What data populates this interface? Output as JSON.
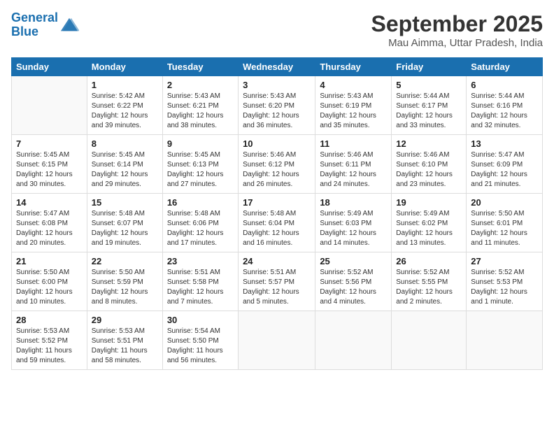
{
  "logo": {
    "line1": "General",
    "line2": "Blue"
  },
  "title": "September 2025",
  "subtitle": "Mau Aimma, Uttar Pradesh, India",
  "weekdays": [
    "Sunday",
    "Monday",
    "Tuesday",
    "Wednesday",
    "Thursday",
    "Friday",
    "Saturday"
  ],
  "weeks": [
    [
      {
        "day": "",
        "info": ""
      },
      {
        "day": "1",
        "info": "Sunrise: 5:42 AM\nSunset: 6:22 PM\nDaylight: 12 hours\nand 39 minutes."
      },
      {
        "day": "2",
        "info": "Sunrise: 5:43 AM\nSunset: 6:21 PM\nDaylight: 12 hours\nand 38 minutes."
      },
      {
        "day": "3",
        "info": "Sunrise: 5:43 AM\nSunset: 6:20 PM\nDaylight: 12 hours\nand 36 minutes."
      },
      {
        "day": "4",
        "info": "Sunrise: 5:43 AM\nSunset: 6:19 PM\nDaylight: 12 hours\nand 35 minutes."
      },
      {
        "day": "5",
        "info": "Sunrise: 5:44 AM\nSunset: 6:17 PM\nDaylight: 12 hours\nand 33 minutes."
      },
      {
        "day": "6",
        "info": "Sunrise: 5:44 AM\nSunset: 6:16 PM\nDaylight: 12 hours\nand 32 minutes."
      }
    ],
    [
      {
        "day": "7",
        "info": "Sunrise: 5:45 AM\nSunset: 6:15 PM\nDaylight: 12 hours\nand 30 minutes."
      },
      {
        "day": "8",
        "info": "Sunrise: 5:45 AM\nSunset: 6:14 PM\nDaylight: 12 hours\nand 29 minutes."
      },
      {
        "day": "9",
        "info": "Sunrise: 5:45 AM\nSunset: 6:13 PM\nDaylight: 12 hours\nand 27 minutes."
      },
      {
        "day": "10",
        "info": "Sunrise: 5:46 AM\nSunset: 6:12 PM\nDaylight: 12 hours\nand 26 minutes."
      },
      {
        "day": "11",
        "info": "Sunrise: 5:46 AM\nSunset: 6:11 PM\nDaylight: 12 hours\nand 24 minutes."
      },
      {
        "day": "12",
        "info": "Sunrise: 5:46 AM\nSunset: 6:10 PM\nDaylight: 12 hours\nand 23 minutes."
      },
      {
        "day": "13",
        "info": "Sunrise: 5:47 AM\nSunset: 6:09 PM\nDaylight: 12 hours\nand 21 minutes."
      }
    ],
    [
      {
        "day": "14",
        "info": "Sunrise: 5:47 AM\nSunset: 6:08 PM\nDaylight: 12 hours\nand 20 minutes."
      },
      {
        "day": "15",
        "info": "Sunrise: 5:48 AM\nSunset: 6:07 PM\nDaylight: 12 hours\nand 19 minutes."
      },
      {
        "day": "16",
        "info": "Sunrise: 5:48 AM\nSunset: 6:06 PM\nDaylight: 12 hours\nand 17 minutes."
      },
      {
        "day": "17",
        "info": "Sunrise: 5:48 AM\nSunset: 6:04 PM\nDaylight: 12 hours\nand 16 minutes."
      },
      {
        "day": "18",
        "info": "Sunrise: 5:49 AM\nSunset: 6:03 PM\nDaylight: 12 hours\nand 14 minutes."
      },
      {
        "day": "19",
        "info": "Sunrise: 5:49 AM\nSunset: 6:02 PM\nDaylight: 12 hours\nand 13 minutes."
      },
      {
        "day": "20",
        "info": "Sunrise: 5:50 AM\nSunset: 6:01 PM\nDaylight: 12 hours\nand 11 minutes."
      }
    ],
    [
      {
        "day": "21",
        "info": "Sunrise: 5:50 AM\nSunset: 6:00 PM\nDaylight: 12 hours\nand 10 minutes."
      },
      {
        "day": "22",
        "info": "Sunrise: 5:50 AM\nSunset: 5:59 PM\nDaylight: 12 hours\nand 8 minutes."
      },
      {
        "day": "23",
        "info": "Sunrise: 5:51 AM\nSunset: 5:58 PM\nDaylight: 12 hours\nand 7 minutes."
      },
      {
        "day": "24",
        "info": "Sunrise: 5:51 AM\nSunset: 5:57 PM\nDaylight: 12 hours\nand 5 minutes."
      },
      {
        "day": "25",
        "info": "Sunrise: 5:52 AM\nSunset: 5:56 PM\nDaylight: 12 hours\nand 4 minutes."
      },
      {
        "day": "26",
        "info": "Sunrise: 5:52 AM\nSunset: 5:55 PM\nDaylight: 12 hours\nand 2 minutes."
      },
      {
        "day": "27",
        "info": "Sunrise: 5:52 AM\nSunset: 5:53 PM\nDaylight: 12 hours\nand 1 minute."
      }
    ],
    [
      {
        "day": "28",
        "info": "Sunrise: 5:53 AM\nSunset: 5:52 PM\nDaylight: 11 hours\nand 59 minutes."
      },
      {
        "day": "29",
        "info": "Sunrise: 5:53 AM\nSunset: 5:51 PM\nDaylight: 11 hours\nand 58 minutes."
      },
      {
        "day": "30",
        "info": "Sunrise: 5:54 AM\nSunset: 5:50 PM\nDaylight: 11 hours\nand 56 minutes."
      },
      {
        "day": "",
        "info": ""
      },
      {
        "day": "",
        "info": ""
      },
      {
        "day": "",
        "info": ""
      },
      {
        "day": "",
        "info": ""
      }
    ]
  ]
}
